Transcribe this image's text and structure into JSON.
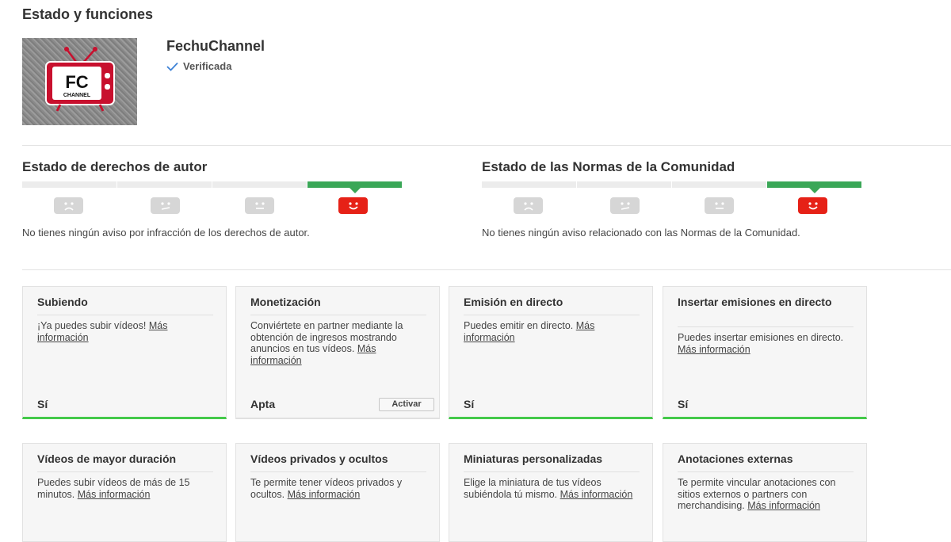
{
  "page": {
    "title": "Estado y funciones"
  },
  "channel": {
    "name": "FechuChannel",
    "verified_label": "Verificada",
    "logo_text": "FC",
    "logo_subtext": "CHANNEL"
  },
  "copyright": {
    "title": "Estado de derechos de autor",
    "message": "No tienes ningún aviso por infracción de los derechos de autor.",
    "active_segment": 4
  },
  "community": {
    "title": "Estado de las Normas de la Comunidad",
    "message": "No tienes ningún aviso relacionado con las Normas de la Comunidad.",
    "active_segment": 4
  },
  "colors": {
    "active_status": "#3aa757",
    "face_active": "#e62117",
    "feature_enabled": "#44c94a"
  },
  "cards": [
    {
      "title": "Subiendo",
      "desc": "¡Ya puedes subir vídeos!",
      "link": "Más información",
      "status": "Sí"
    },
    {
      "title": "Monetización",
      "desc": "Conviértete en partner mediante la obtención de ingresos mostrando anuncios en tus vídeos.",
      "link": "Más información",
      "status": "Apta",
      "button": "Activar"
    },
    {
      "title": "Emisión en directo",
      "desc": "Puedes emitir en directo.",
      "link": "Más información",
      "status": "Sí"
    },
    {
      "title": "Insertar emisiones en directo",
      "desc": "Puedes insertar emisiones en directo.",
      "link": "Más información",
      "status": "Sí"
    },
    {
      "title": "Vídeos de mayor duración",
      "desc": "Puedes subir vídeos de más de 15 minutos.",
      "link": "Más información"
    },
    {
      "title": "Vídeos privados y ocultos",
      "desc": "Te permite tener vídeos privados y ocultos.",
      "link": "Más información"
    },
    {
      "title": "Miniaturas personalizadas",
      "desc": "Elige la miniatura de tus vídeos subiéndola tú mismo.",
      "link": "Más información"
    },
    {
      "title": "Anotaciones externas",
      "desc": "Te permite vincular anotaciones con sitios externos o partners con merchandising.",
      "link": "Más información"
    }
  ]
}
